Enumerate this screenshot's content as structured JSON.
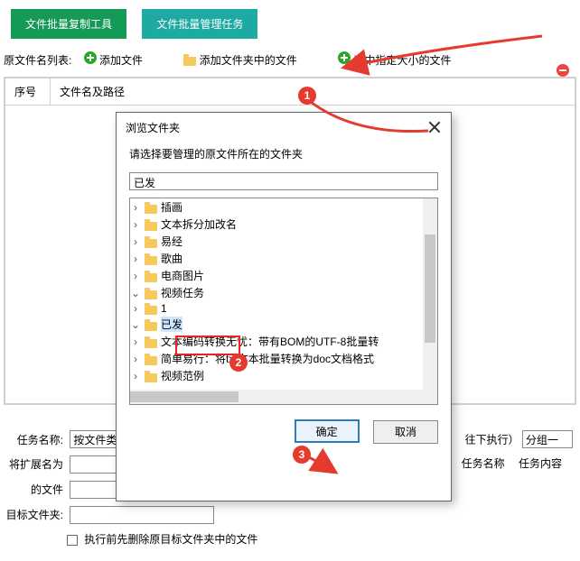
{
  "top": {
    "copy_tool": "文件批量复制工具",
    "manage_tasks": "文件批量管理任务"
  },
  "toolbar": {
    "list_label": "原文件名列表:",
    "add_file": "添加文件",
    "add_folder_files": "添加文件夹中的文件",
    "select_by_size": "选中指定大小的文件"
  },
  "columns": {
    "no": "序号",
    "path": "文件名及路径"
  },
  "form": {
    "task_name_label": "任务名称:",
    "task_name_value": "按文件类型",
    "keep_exec_prefix": "往下执行）",
    "group_label": "分组一",
    "ext_label": "将扩展名为",
    "name_label": "任务名称",
    "content_label": "任务内容",
    "file_of": "的文件",
    "target_label": "目标文件夹:",
    "delete_first": "执行前先删除原目标文件夹中的文件"
  },
  "modal": {
    "title": "浏览文件夹",
    "subtitle": "请选择要管理的原文件所在的文件夹",
    "path_value": "已发",
    "ok": "确定",
    "cancel": "取消"
  },
  "tree": {
    "items": [
      {
        "depth": 0,
        "label": "插画"
      },
      {
        "depth": 0,
        "label": "文本拆分加改名"
      },
      {
        "depth": 0,
        "label": "易经"
      },
      {
        "depth": 0,
        "label": "歌曲"
      },
      {
        "depth": 0,
        "label": "电商图片"
      },
      {
        "depth": 0,
        "label": "视频任务",
        "expanded": true
      },
      {
        "depth": 1,
        "label": "1"
      },
      {
        "depth": 1,
        "label": "已发",
        "expanded": true,
        "selected": true
      },
      {
        "depth": 2,
        "label": "文本编码转换无忧：带有BOM的UTF-8批量转"
      },
      {
        "depth": 2,
        "label": "简单易行：将txt文本批量转换为doc文档格式"
      },
      {
        "depth": 1,
        "label": "视频范例"
      }
    ]
  },
  "badges": {
    "b1": "1",
    "b2": "2",
    "b3": "3"
  }
}
